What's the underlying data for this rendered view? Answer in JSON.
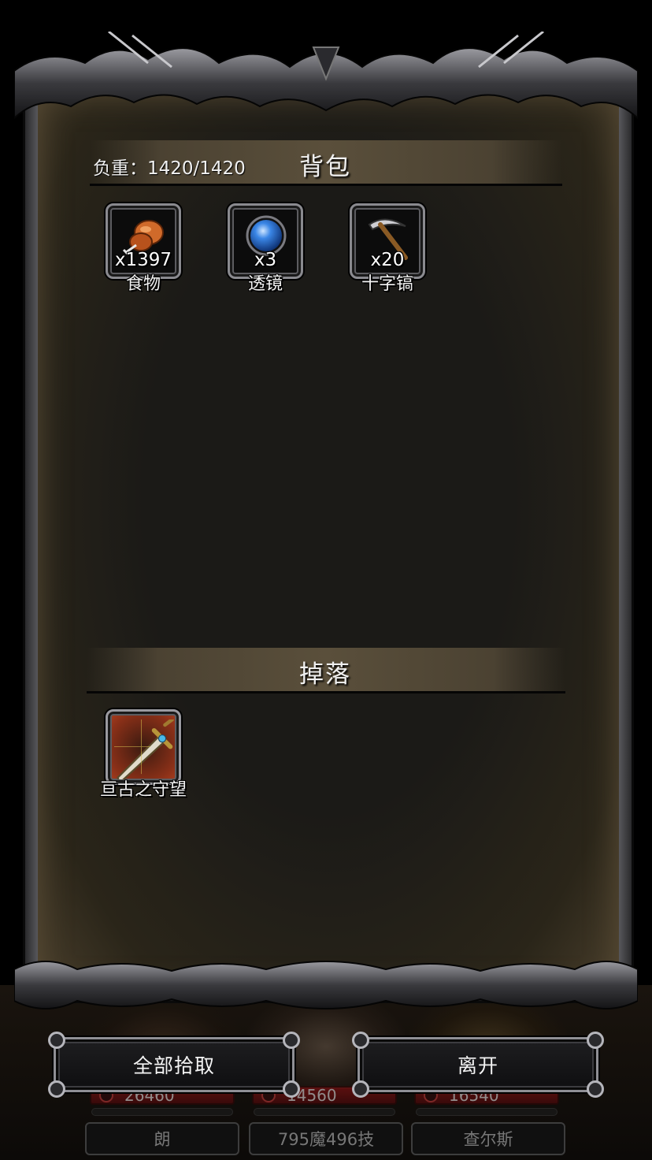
{
  "inventory": {
    "title": "背包",
    "weight_label": "负重：1420/1420",
    "items": [
      {
        "name": "食物",
        "count": "x1397",
        "icon": "food-icon"
      },
      {
        "name": "透镜",
        "count": "x3",
        "icon": "lens-orb-icon"
      },
      {
        "name": "十字镐",
        "count": "x20",
        "icon": "pickaxe-icon"
      }
    ]
  },
  "loot": {
    "title": "掉落",
    "items": [
      {
        "name": "亘古之守望",
        "count": "",
        "icon": "sword-icon",
        "rarity": "legendary"
      }
    ]
  },
  "buttons": {
    "pickup_all": "全部拾取",
    "leave": "离开"
  },
  "party": [
    {
      "hp": "26460",
      "name": "朗"
    },
    {
      "hp": "14560",
      "name": "795魔496技"
    },
    {
      "hp": "16540",
      "name": "查尔斯"
    }
  ],
  "colors": {
    "legendary_slot": "#8a3018",
    "hp_bar": "#7a1012",
    "header_bar": "#5a4f3b"
  }
}
